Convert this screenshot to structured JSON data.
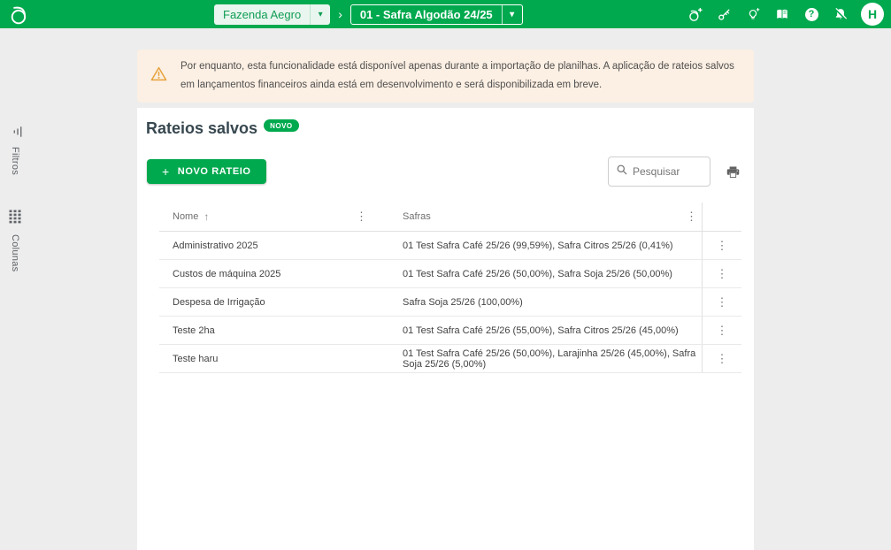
{
  "header": {
    "farm_selector": {
      "label": "Fazenda Aegro"
    },
    "breadcrumb_separator": "›",
    "harvest_selector": {
      "label": "01 - Safra Algodão 24/25"
    },
    "icons": [
      "add-farm",
      "key",
      "idea-bulb",
      "knowledge-book",
      "help",
      "notifications-off"
    ],
    "help_glyph": "?",
    "avatar_initial": "H",
    "accent_color": "#00a94e"
  },
  "banner": {
    "text": "Por enquanto, esta funcionalidade está disponível apenas durante a importação de planilhas. A aplicação de rateios salvos em lançamentos financeiros ainda está em desenvolvimento e será disponibilizada em breve.",
    "background_color": "#fcefe3",
    "icon": "warning-triangle",
    "icon_color": "#e7a23b"
  },
  "page": {
    "title": "Rateios salvos",
    "badge": "NOVO",
    "new_button_label": "NOVO RATEIO",
    "new_button_plus": "+",
    "search_placeholder": "Pesquisar"
  },
  "side_tabs": [
    {
      "label": "Filtros",
      "icon": "filter-icon"
    },
    {
      "label": "Colunas",
      "icon": "columns-grid-icon"
    }
  ],
  "table": {
    "columns": [
      "Nome",
      "Safras"
    ],
    "sort": {
      "column": "Nome",
      "direction": "asc",
      "glyph": "↑"
    },
    "kebab_glyph": "⋮",
    "rows": [
      {
        "nome": "Administrativo 2025",
        "safras": "01 Test Safra Café 25/26 (99,59%), Safra Citros 25/26 (0,41%)"
      },
      {
        "nome": "Custos de máquina 2025",
        "safras": "01 Test Safra Café 25/26 (50,00%), Safra Soja 25/26 (50,00%)"
      },
      {
        "nome": "Despesa de Irrigação",
        "safras": "Safra Soja 25/26 (100,00%)"
      },
      {
        "nome": "Teste 2ha",
        "safras": "01 Test Safra Café 25/26 (55,00%), Safra Citros 25/26 (45,00%)"
      },
      {
        "nome": "Teste haru",
        "safras": "01 Test Safra Café 25/26 (50,00%), Larajinha 25/26 (45,00%), Safra Soja 25/26 (5,00%)"
      }
    ]
  }
}
